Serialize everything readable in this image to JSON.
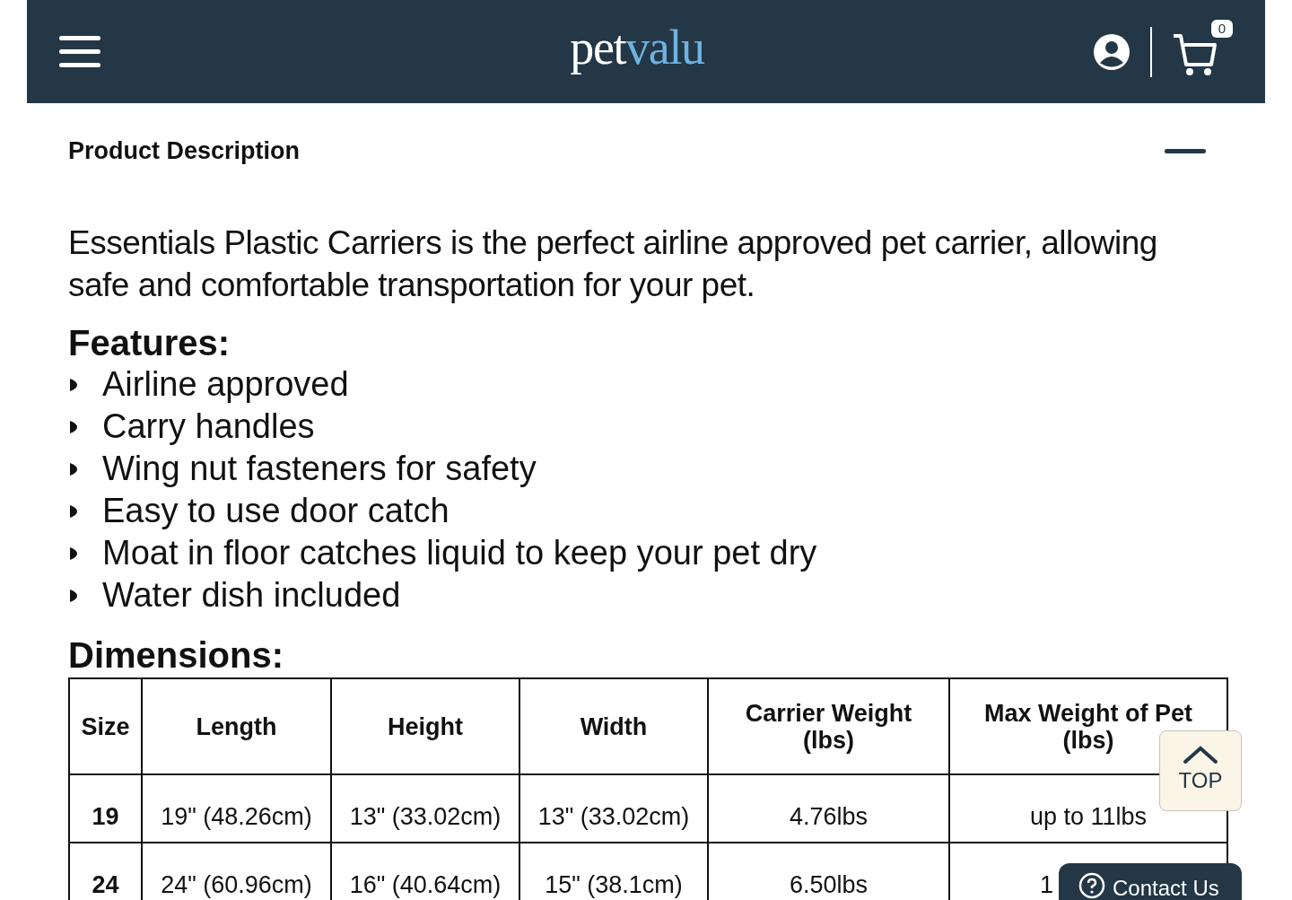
{
  "header": {
    "logo": {
      "first": "pet",
      "second": "valu"
    },
    "cart_count": "0"
  },
  "section": {
    "title": "Product Description",
    "expanded": true
  },
  "description": "Essentials Plastic Carriers is the perfect airline approved pet carrier, allowing safe and comfortable transportation for your pet.",
  "features": {
    "heading": "Features:",
    "items": [
      "Airline approved",
      "Carry handles",
      "Wing nut fasteners for safety",
      "Easy to use door catch",
      "Moat in floor catches liquid to keep your pet dry",
      "Water dish included"
    ]
  },
  "dimensions": {
    "heading": "Dimensions:",
    "table": {
      "columns": [
        "Size",
        "Length",
        "Height",
        "Width",
        "Carrier Weight (lbs)",
        "Max Weight of Pet (lbs)"
      ],
      "rows": [
        [
          "19",
          "19\" (48.26cm)",
          "13\" (33.02cm)",
          "13\" (33.02cm)",
          "4.76lbs",
          "up to 11lbs"
        ],
        [
          "24",
          "24\" (60.96cm)",
          "16\" (40.64cm)",
          "15\" (38.1cm)",
          "6.50lbs",
          "1"
        ]
      ]
    }
  },
  "top_button": "TOP",
  "contact_button": "Contact Us"
}
